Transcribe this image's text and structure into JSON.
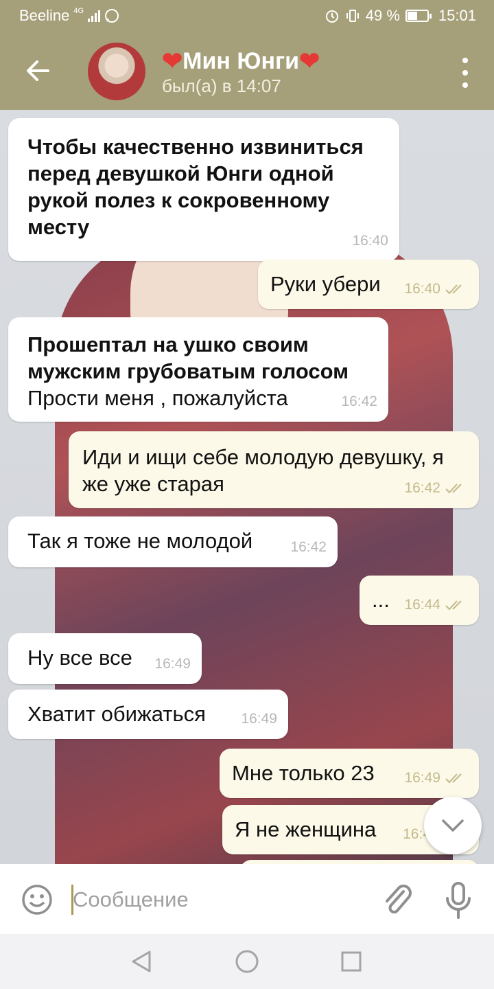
{
  "status_bar": {
    "carrier": "Beeline",
    "network": "4G",
    "battery": "49 %",
    "time": "15:01"
  },
  "header": {
    "contact_name": "Мин Юнги",
    "status": "был(а) в 14:07"
  },
  "messages": [
    {
      "dir": "in",
      "lines_bold": "Чтобы качественно извиниться перед девушкой Юнги одной рукой полез к сокровенному месту",
      "lines": "",
      "time": "16:40"
    },
    {
      "dir": "out",
      "lines": "Руки убери",
      "time": "16:40"
    },
    {
      "dir": "in",
      "lines_bold": "Прошептал на ушко своим мужским грубоватым голосом",
      "lines": "Прости меня , пожалуйста",
      "time": "16:42"
    },
    {
      "dir": "out",
      "lines": "Иди и ищи себе молодую девушку, я же уже старая",
      "time": "16:42"
    },
    {
      "dir": "in",
      "lines": "Так я тоже не молодой",
      "time": "16:42"
    },
    {
      "dir": "out",
      "lines": "...",
      "time": "16:44"
    },
    {
      "dir": "in",
      "lines": "Ну все все",
      "time": "16:49"
    },
    {
      "dir": "in",
      "lines": "Хватит обижаться",
      "time": "16:49"
    },
    {
      "dir": "out",
      "lines": "Мне только 23",
      "time": "16:49"
    },
    {
      "dir": "out",
      "lines": "Я не женщина",
      "time": "16:4"
    }
  ],
  "composer": {
    "placeholder": "Сообщение"
  },
  "icons": {
    "back": "arrow-left-icon",
    "menu": "more-vert-icon",
    "emoji": "smiley-icon",
    "attach": "paperclip-icon",
    "mic": "microphone-icon",
    "scroll": "chevron-down-icon"
  },
  "colors": {
    "header": "#a6a07a",
    "outgoing_bubble": "#fcf9e8",
    "incoming_bubble": "#ffffff",
    "ticks": "#c3b98c",
    "heart": "#e53935"
  }
}
